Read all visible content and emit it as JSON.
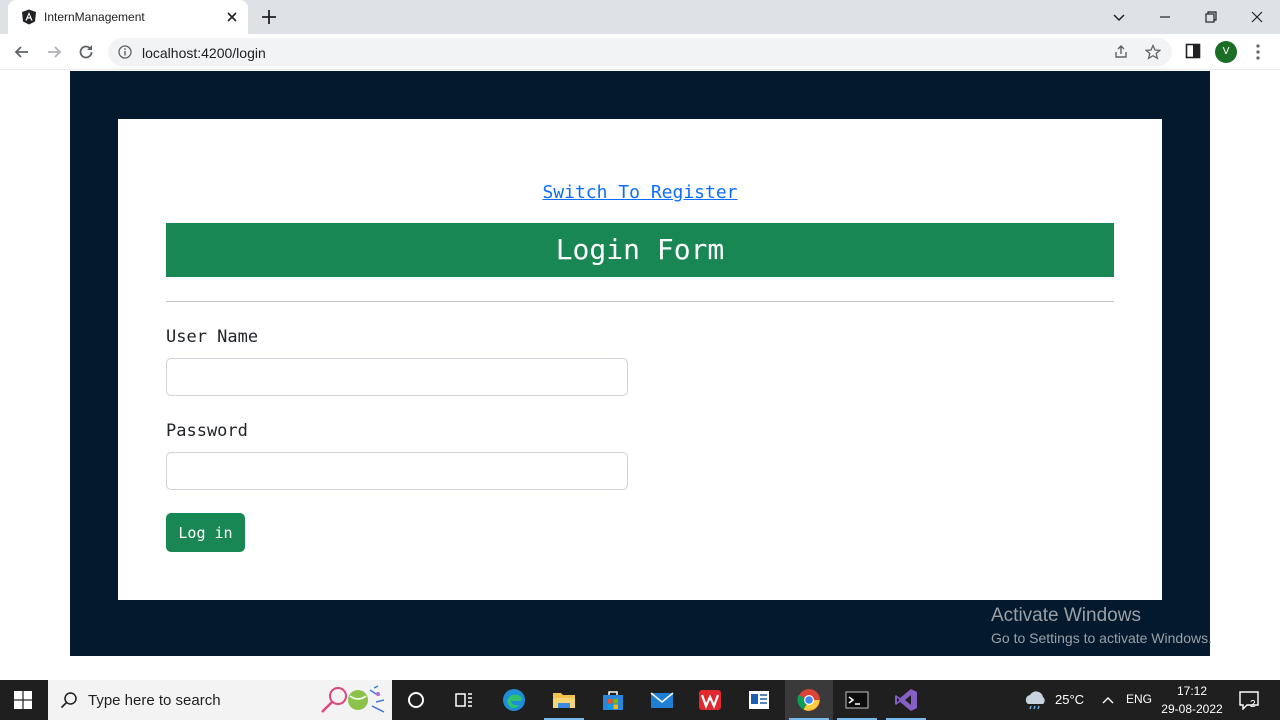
{
  "browser": {
    "tab_title": "InternManagement",
    "url": "localhost:4200/login",
    "profile_initial": "V"
  },
  "page": {
    "switch_link": "Switch To Register",
    "form_title": "Login Form",
    "username_label": "User Name",
    "username_value": "",
    "password_label": "Password",
    "password_value": "",
    "login_button": "Log in",
    "colors": {
      "outer_bg": "#03192d",
      "header_bg": "#198754",
      "link": "#0d6efd"
    }
  },
  "watermark": {
    "title": "Activate Windows",
    "subtitle": "Go to Settings to activate Windows."
  },
  "taskbar": {
    "search_placeholder": "Type here to search",
    "apps": [
      "cortana-icon",
      "task-view-icon",
      "edge-icon",
      "file-explorer-icon",
      "store-icon",
      "mail-icon",
      "wps-icon",
      "news-icon",
      "chrome-icon",
      "terminal-icon",
      "visual-studio-icon"
    ],
    "temperature": "25°C",
    "language": "ENG",
    "time": "17:12",
    "date": "29-08-2022",
    "notification_count": "2"
  }
}
